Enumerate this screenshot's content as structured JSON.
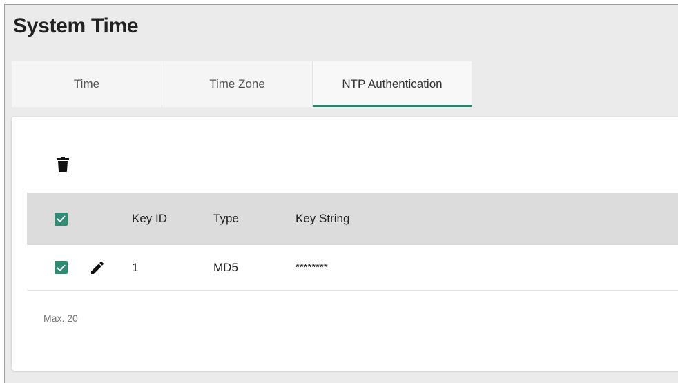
{
  "page": {
    "title": "System Time"
  },
  "tabs": [
    {
      "label": "Time",
      "active": false
    },
    {
      "label": "Time Zone",
      "active": false
    },
    {
      "label": "NTP Authentication",
      "active": true
    }
  ],
  "toolbar": {
    "delete_icon": "trash-icon"
  },
  "table": {
    "columns": {
      "key_id": "Key ID",
      "type": "Type",
      "key_string": "Key String"
    },
    "header_checked": true,
    "rows": [
      {
        "checked": true,
        "key_id": "1",
        "type": "MD5",
        "key_string": "********"
      }
    ]
  },
  "footer": {
    "max_note": "Max. 20"
  },
  "colors": {
    "accent": "#26876f",
    "checkbox": "#2e8b74",
    "header_bg": "#dcdcdc",
    "page_bg": "#ebebeb"
  }
}
